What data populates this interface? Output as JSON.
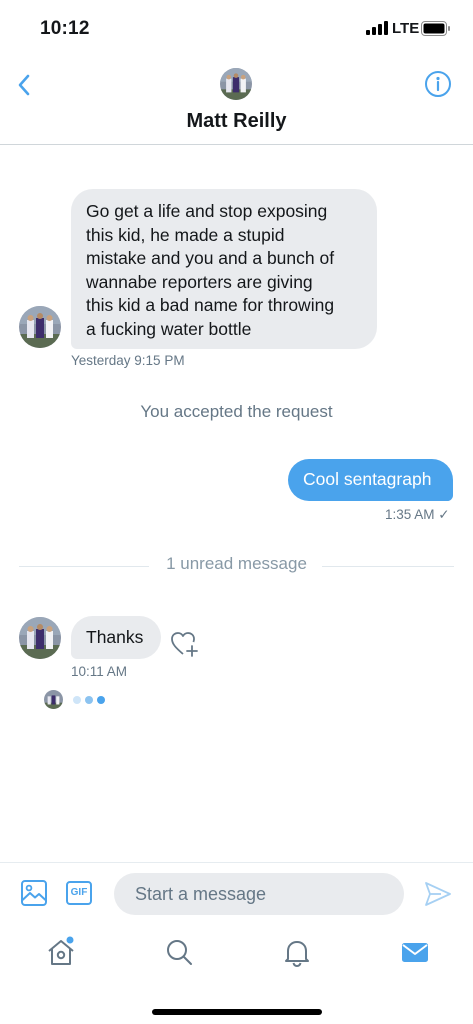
{
  "status_bar": {
    "time": "10:12",
    "network": "LTE"
  },
  "header": {
    "contact_name": "Matt Reilly",
    "back_icon": "chevron-left-icon",
    "info_icon": "info-icon"
  },
  "conversation": {
    "messages": [
      {
        "direction": "incoming",
        "lines": [
          "Go get a life and stop exposing",
          "this kid, he made a stupid",
          "mistake and you and a bunch of",
          "wannabe reporters are giving",
          "this kid a bad name for throwing",
          "a fucking water bottle"
        ],
        "timestamp": "Yesterday 9:15 PM"
      },
      {
        "direction": "system",
        "text": "You accepted the request"
      },
      {
        "direction": "outgoing",
        "text": "Cool sentagraph",
        "timestamp": "1:35 AM ✓"
      },
      {
        "direction": "divider",
        "text": "1 unread message"
      },
      {
        "direction": "incoming",
        "text": "Thanks",
        "timestamp": "10:11 AM"
      }
    ],
    "typing_indicator": true
  },
  "composer": {
    "placeholder": "Start a message",
    "gif_label": "GIF"
  },
  "tab_bar": {
    "tabs": [
      "home-icon",
      "search-icon",
      "notifications-icon",
      "messages-icon"
    ],
    "active": "messages-icon"
  },
  "colors": {
    "accent": "#4aa3ec",
    "incoming_bubble": "#e9ebee",
    "secondary_text": "#657786"
  }
}
